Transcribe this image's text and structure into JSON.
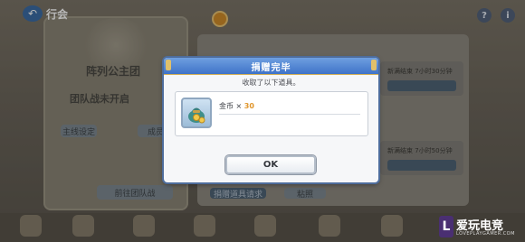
{
  "header": {
    "title": "行会",
    "back_icon": "back-arrow-icon",
    "help_label": "?",
    "info_label": "i"
  },
  "background": {
    "guild_name": "阵列公主团",
    "battle_status": "团队战未开启",
    "goto_battle": "前往团队战",
    "left_btn1": "主线设定",
    "left_btn2": "成员",
    "card1_text": "新满结束 7小时30分钟",
    "card2_text": "新满结束 7小时50分钟",
    "bottom_btn1": "捐赠道具请求",
    "bottom_btn2": "粘照"
  },
  "dialog": {
    "title": "捐赠完毕",
    "message": "收取了以下道具。",
    "item": {
      "name": "金币",
      "multiplier": "×",
      "count": "30",
      "icon": "coin-bag-icon"
    },
    "ok_label": "OK"
  },
  "watermark": {
    "brand_char": "L",
    "brand": "爱玩电竞",
    "sub": "LOVEPLAYGAMER.COM"
  },
  "colors": {
    "header_blue": "#3f73c8",
    "gold_accent": "#e0962c",
    "dialog_bg": "#f6f7f9"
  }
}
